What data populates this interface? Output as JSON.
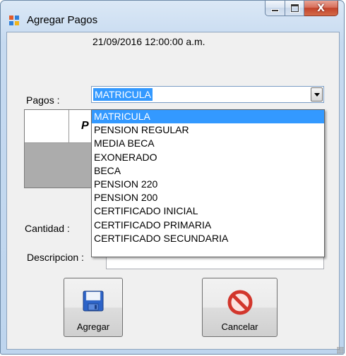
{
  "window": {
    "title": "Agregar Pagos",
    "close_glyph": "X"
  },
  "form": {
    "datetime": "21/09/2016 12:00:00 a.m.",
    "pagos_label": "Pagos :",
    "pagos_selected": "MATRICULA",
    "grid_column_partial": "P",
    "cantidad_label": "Cantidad :",
    "descripcion_label": "Descripcion :"
  },
  "dropdown": {
    "items": [
      "MATRICULA",
      "PENSION REGULAR",
      "MEDIA BECA",
      "EXONERADO",
      "BECA",
      "PENSION 220",
      "PENSION 200",
      "CERTIFICADO INICIAL",
      "CERTIFICADO PRIMARIA",
      "CERTIFICADO SECUNDARIA"
    ],
    "selected_index": 0
  },
  "buttons": {
    "agregar": {
      "label": "Agregar",
      "icon": "floppy-disk-icon"
    },
    "cancelar": {
      "label": "Cancelar",
      "icon": "prohibited-icon"
    }
  },
  "colors": {
    "selection": "#3399ff",
    "client_bg": "#f0f0f0"
  }
}
